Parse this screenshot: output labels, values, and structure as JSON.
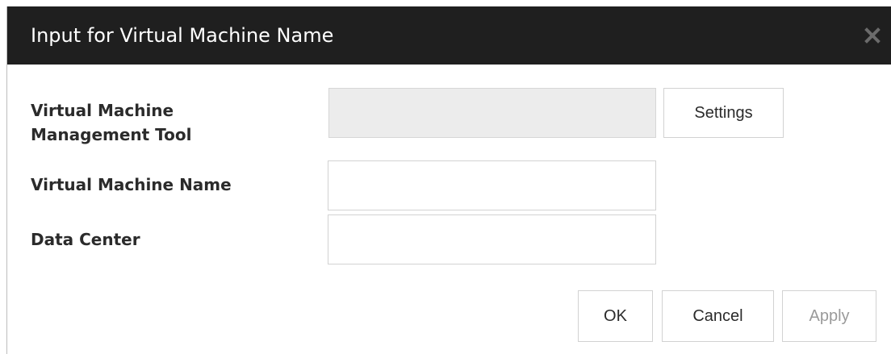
{
  "dialog": {
    "title": "Input for Virtual Machine Name",
    "close_icon": "close-icon"
  },
  "form": {
    "vm_tool": {
      "label_line1": "Virtual Machine",
      "label_line2": "Management Tool",
      "value": "",
      "settings_label": "Settings"
    },
    "vm_name": {
      "label": "Virtual Machine Name",
      "value": ""
    },
    "data_center": {
      "label": "Data Center",
      "value": ""
    }
  },
  "footer": {
    "ok_label": "OK",
    "cancel_label": "Cancel",
    "apply_label": "Apply"
  },
  "colors": {
    "titlebar": "#1f1f1f",
    "readonly_field": "#ececec",
    "disabled_text": "#9a9a9a"
  }
}
